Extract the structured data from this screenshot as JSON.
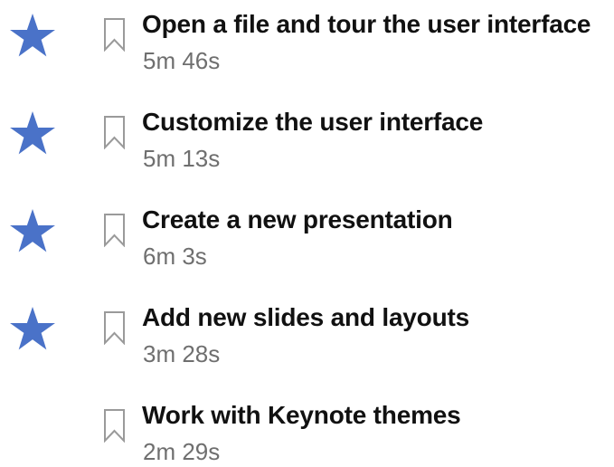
{
  "colors": {
    "star": "#4a72c8",
    "title": "#111111",
    "duration": "#6f6f6f",
    "bookmark": "#9a9a9a"
  },
  "course_items": [
    {
      "title": "Open a file and tour the user interface",
      "duration": "5m 46s",
      "starred": true,
      "star_icon": "star-icon",
      "bookmark_icon": "bookmark-icon"
    },
    {
      "title": "Customize the user interface",
      "duration": "5m 13s",
      "starred": true,
      "star_icon": "star-icon",
      "bookmark_icon": "bookmark-icon"
    },
    {
      "title": "Create a new presentation",
      "duration": "6m 3s",
      "starred": true,
      "star_icon": "star-icon",
      "bookmark_icon": "bookmark-icon"
    },
    {
      "title": "Add new slides and layouts",
      "duration": "3m 28s",
      "starred": true,
      "star_icon": "star-icon",
      "bookmark_icon": "bookmark-icon"
    },
    {
      "title": "Work with Keynote themes",
      "duration": "2m 29s",
      "starred": false,
      "bookmark_icon": "bookmark-icon"
    }
  ]
}
